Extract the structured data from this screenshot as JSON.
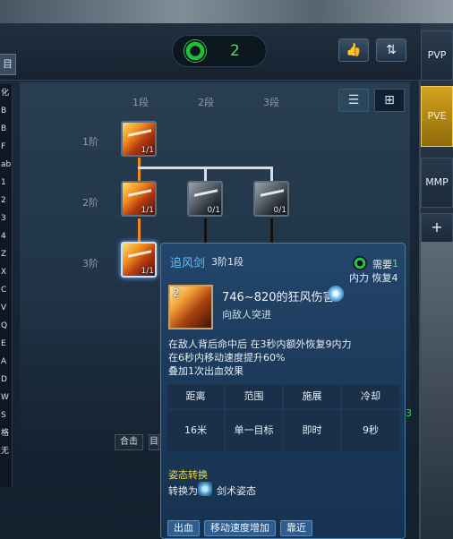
{
  "header": {
    "counter_value": "2",
    "like_label": "👍",
    "sort_label": "⇅",
    "left_btn_label": "目"
  },
  "left_list": {
    "items": [
      "化",
      "B",
      "B",
      "F",
      "ab",
      "1",
      "2",
      "3",
      "4",
      "Z",
      "X",
      "C",
      "V",
      "Q",
      "E",
      "A",
      "D",
      "W",
      "S",
      "格",
      "无"
    ]
  },
  "tree": {
    "columns": [
      "1段",
      "2段",
      "3段"
    ],
    "rows": [
      "1阶",
      "2阶",
      "3阶"
    ],
    "nodes": [
      {
        "count": "1/1"
      },
      {
        "count": "1/1"
      },
      {
        "count": "0/1"
      },
      {
        "count": "0/1"
      },
      {
        "count": "1/1"
      }
    ],
    "list_view": "☰",
    "grid_view": "⊞"
  },
  "bottom_buttons": [
    "合击",
    "目"
  ],
  "side_tabs": [
    {
      "label": "PVP"
    },
    {
      "label": "PVE"
    },
    {
      "label": "MMP"
    },
    {
      "label": "+"
    }
  ],
  "tooltip": {
    "name": "追风剑",
    "level": "3阶1段",
    "req_label": "需要",
    "req_value": "1",
    "cost": "内力 恢复4",
    "icon_num": "2",
    "damage": "746~820的狂风伤害",
    "sub": "向敌人突进",
    "desc": [
      "在敌人背后命中后 在3秒内额外恢复9内力",
      "在6秒内移动速度提升60%",
      "叠加1次出血效果"
    ],
    "grid_headers": [
      "距离",
      "范围",
      "施展",
      "冷却"
    ],
    "grid_values": [
      "16米",
      "单一目标",
      "即时",
      "9秒"
    ],
    "stance_title": "姿态转换",
    "stance_prefix": "转换为",
    "stance_value": "剑术姿态",
    "tags": [
      "出血",
      "移动速度增加",
      "靠近"
    ]
  },
  "right_num": "3"
}
